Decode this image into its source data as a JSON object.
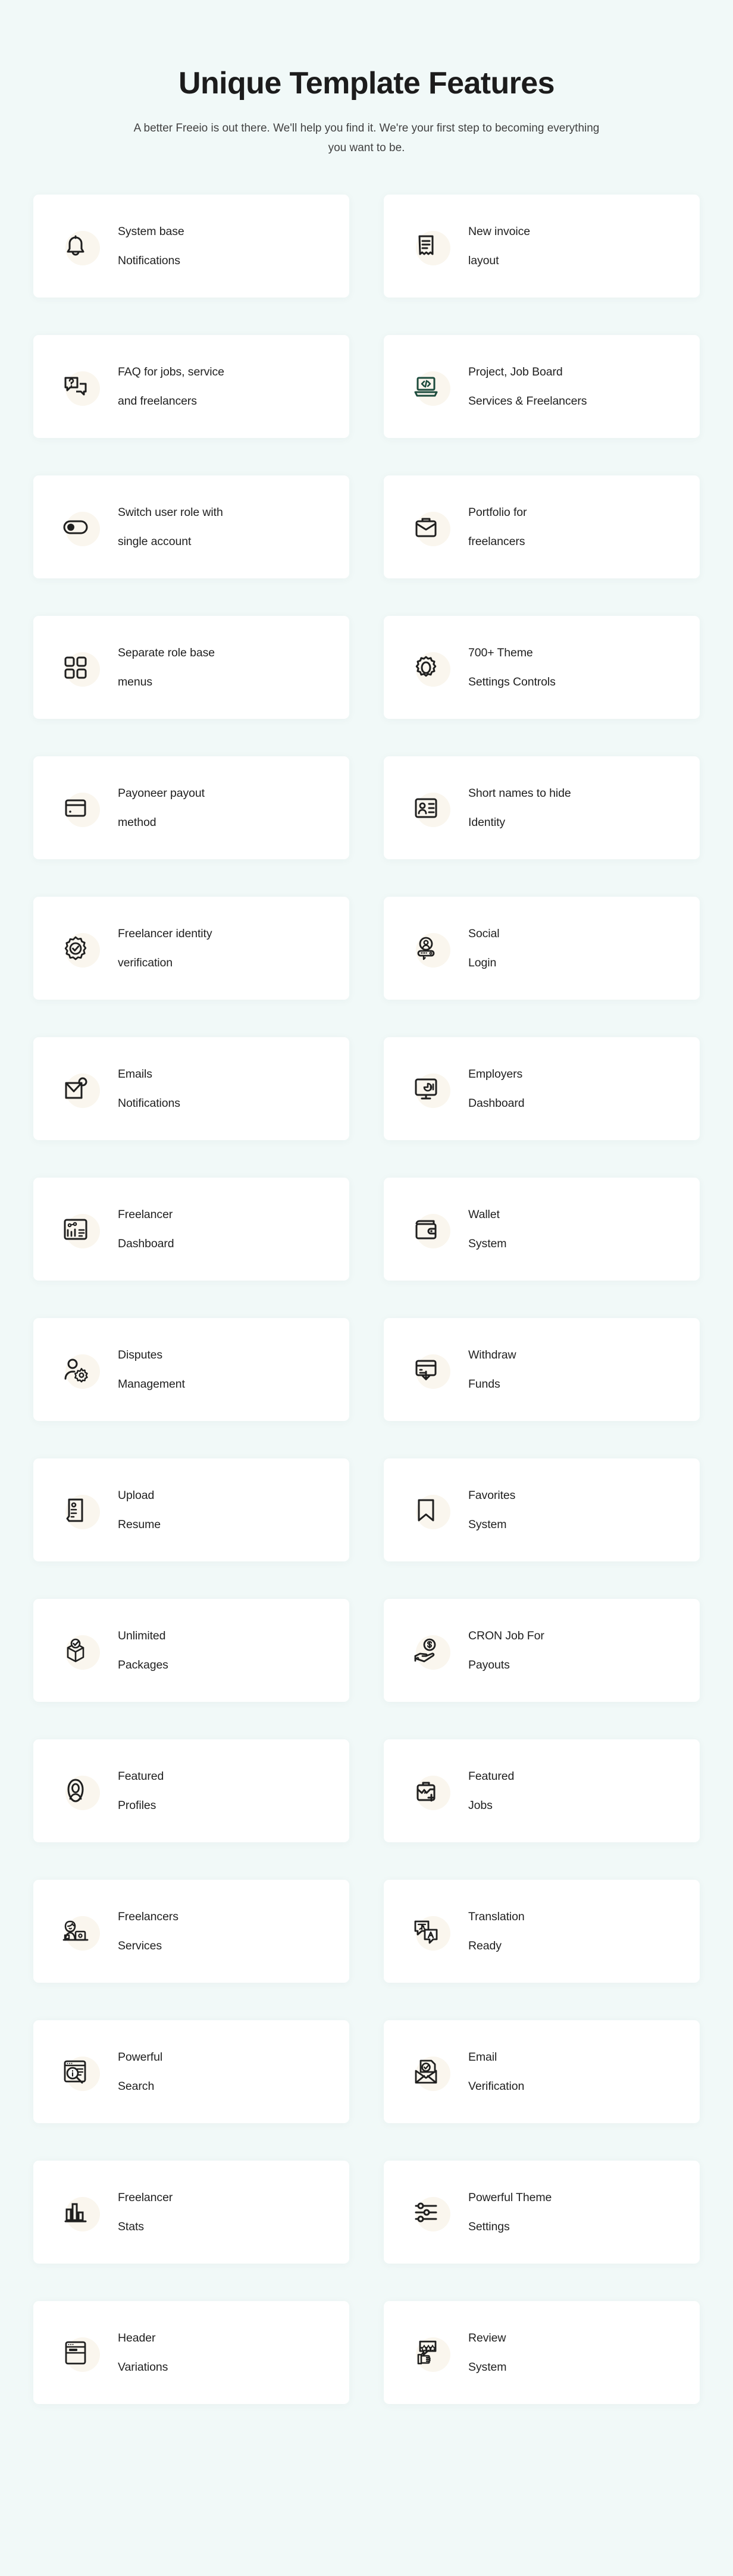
{
  "hero": {
    "title": "Unique Template Features",
    "subtitle": "A better Freeio is out there. We'll help you find it. We're your first step to becoming everything you want to be."
  },
  "colors": {
    "page_background": "#f1f9f8",
    "card_background": "#ffffff",
    "icon_blob": "#faf6ee",
    "heading_text": "#1c1c1c",
    "body_text": "#414141",
    "label_text": "#1f1f1f",
    "icon_dark": "#1f1f1f",
    "icon_green": "#1d4c3d"
  },
  "features": [
    {
      "icon": "bell-icon",
      "line1": "System base",
      "line2": "Notifications"
    },
    {
      "icon": "invoice-receipt-icon",
      "line1": "New invoice",
      "line2": "layout"
    },
    {
      "icon": "faq-chat-icon",
      "line1": "FAQ for jobs, service",
      "line2": "and freelancers"
    },
    {
      "icon": "laptop-code-icon",
      "line1": "Project, Job Board",
      "line2": "Services & Freelancers"
    },
    {
      "icon": "toggle-switch-icon",
      "line1": "Switch user role with",
      "line2": "single account"
    },
    {
      "icon": "briefcase-icon",
      "line1": "Portfolio for",
      "line2": "freelancers"
    },
    {
      "icon": "grid-menu-icon",
      "line1": "Separate role base",
      "line2": "menus"
    },
    {
      "icon": "gear-icon",
      "line1": "700+ Theme",
      "line2": "Settings Controls"
    },
    {
      "icon": "credit-card-icon",
      "line1": "Payoneer payout",
      "line2": "method"
    },
    {
      "icon": "id-card-icon",
      "line1": "Short names to hide",
      "line2": "Identity"
    },
    {
      "icon": "verified-badge-icon",
      "line1": "Freelancer identity",
      "line2": "verification"
    },
    {
      "icon": "social-login-key-icon",
      "line1": "Social",
      "line2": "Login"
    },
    {
      "icon": "email-notification-icon",
      "line1": "Emails",
      "line2": "Notifications"
    },
    {
      "icon": "monitor-chart-icon",
      "line1": "Employers",
      "line2": "Dashboard"
    },
    {
      "icon": "dashboard-report-icon",
      "line1": "Freelancer",
      "line2": "Dashboard"
    },
    {
      "icon": "wallet-icon",
      "line1": "Wallet",
      "line2": "System"
    },
    {
      "icon": "user-settings-icon",
      "line1": "Disputes",
      "line2": "Management"
    },
    {
      "icon": "withdraw-card-icon",
      "line1": "Withdraw",
      "line2": "Funds"
    },
    {
      "icon": "resume-upload-icon",
      "line1": "Upload",
      "line2": "Resume"
    },
    {
      "icon": "bookmark-icon",
      "line1": "Favorites",
      "line2": "System"
    },
    {
      "icon": "open-box-check-icon",
      "line1": "Unlimited",
      "line2": "Packages"
    },
    {
      "icon": "hand-coin-icon",
      "line1": "CRON Job For",
      "line2": "Payouts"
    },
    {
      "icon": "user-avatar-icon",
      "line1": "Featured",
      "line2": "Profiles"
    },
    {
      "icon": "briefcase-plus-icon",
      "line1": "Featured",
      "line2": "Jobs"
    },
    {
      "icon": "freelancer-desk-icon",
      "line1": "Freelancers",
      "line2": "Services"
    },
    {
      "icon": "translate-icon",
      "line1": "Translation",
      "line2": "Ready"
    },
    {
      "icon": "search-browser-icon",
      "line1": "Powerful",
      "line2": "Search"
    },
    {
      "icon": "email-verified-icon",
      "line1": "Email",
      "line2": "Verification"
    },
    {
      "icon": "bar-chart-icon",
      "line1": "Freelancer",
      "line2": "Stats"
    },
    {
      "icon": "sliders-icon",
      "line1": "Powerful Theme",
      "line2": "Settings"
    },
    {
      "icon": "header-layout-icon",
      "line1": "Header",
      "line2": "Variations"
    },
    {
      "icon": "review-thumbsup-icon",
      "line1": "Review",
      "line2": "System"
    }
  ]
}
